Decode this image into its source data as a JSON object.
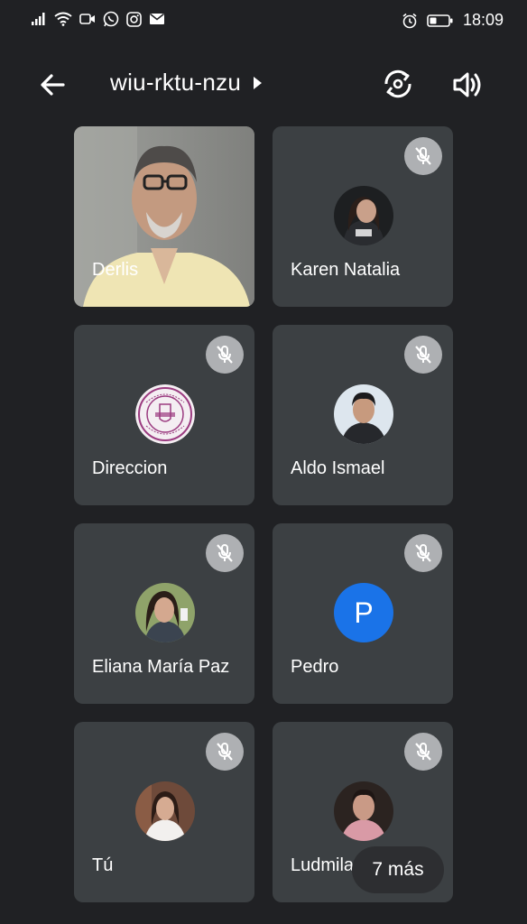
{
  "status_bar": {
    "time": "18:09"
  },
  "header": {
    "meeting_code": "wiu-rktu-nzu"
  },
  "participants": [
    {
      "name": "Derlis",
      "muted": false,
      "avatar": "video-feed"
    },
    {
      "name": "Karen Natalia",
      "muted": true,
      "avatar": "photo"
    },
    {
      "name": "Direccion",
      "muted": true,
      "avatar": "logo-seal"
    },
    {
      "name": "Aldo Ismael",
      "muted": true,
      "avatar": "photo"
    },
    {
      "name": "Eliana María Paz",
      "muted": true,
      "avatar": "photo"
    },
    {
      "name": "Pedro",
      "muted": true,
      "avatar": "letter",
      "initial": "P"
    },
    {
      "name": "Tú",
      "muted": true,
      "avatar": "photo"
    },
    {
      "name": "Ludmila",
      "muted": true,
      "avatar": "photo"
    }
  ],
  "more_button": {
    "label": "7 más"
  },
  "icons": {
    "back": "arrow-back-icon",
    "caret": "caret-right-icon",
    "switch_camera": "switch-camera-icon",
    "speaker": "speaker-icon",
    "mic_off": "mic-off-icon"
  },
  "colors": {
    "background": "#202124",
    "tile": "#3c4043",
    "mute_badge": "#aeb0b3",
    "letter_avatar": "#1a73e8"
  }
}
